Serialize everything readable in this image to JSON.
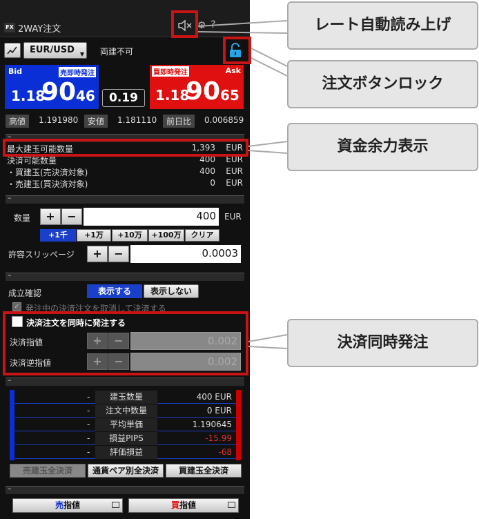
{
  "window": {
    "title": "2WAY注文",
    "app_badge": "FX"
  },
  "toolbar": {
    "pair": "EUR/USD",
    "mode": "両建不可"
  },
  "bid": {
    "label": "Bid",
    "tag": "売即時発注",
    "price_small": "1.18",
    "price_big": "90",
    "price_end": "46"
  },
  "ask": {
    "label": "Ask",
    "tag": "買即時発注",
    "price_small": "1.18",
    "price_big": "90",
    "price_end": "65"
  },
  "spread": "0.19",
  "stats": {
    "high_label": "高値",
    "high": "1.191980",
    "low_label": "安値",
    "low": "1.181110",
    "change_label": "前日比",
    "change": "0.006859"
  },
  "margin": {
    "max_label": "最大建玉可能数量",
    "max_value": "1,393",
    "unit": "EUR",
    "settle_label": "決済可能数量",
    "settle_value": "400",
    "buy_label": "・買建玉(売決済対象)",
    "buy_value": "400",
    "sell_label": "・売建玉(買決済対象)",
    "sell_value": "0"
  },
  "order": {
    "qty_label": "数量",
    "qty_value": "400",
    "qty_unit": "EUR",
    "quick": [
      "+1千",
      "+1万",
      "+10万",
      "+100万",
      "クリア"
    ],
    "slip_label": "許容スリッページ",
    "slip_value": "0.0003",
    "plus": "+",
    "minus": "−"
  },
  "confirm": {
    "label": "成立確認",
    "show": "表示する",
    "hide": "表示しない",
    "cancel_check": "発注中の決済注文を取消して決済する"
  },
  "settle": {
    "check_label": "決済注文を同時に発注する",
    "limit_label": "決済指値",
    "limit_value": "0.002",
    "stop_label": "決済逆指値",
    "stop_value": "0.002"
  },
  "positions": {
    "rows": [
      {
        "label": "建玉数量",
        "left": "-",
        "right": "400 EUR",
        "neg": false
      },
      {
        "label": "注文中数量",
        "left": "-",
        "right": "0 EUR",
        "neg": false
      },
      {
        "label": "平均単価",
        "left": "-",
        "right": "1.190645",
        "neg": false
      },
      {
        "label": "損益PIPS",
        "left": "-",
        "right": "-15.99",
        "neg": true
      },
      {
        "label": "評価損益",
        "left": "-",
        "right": "-68",
        "neg": true
      }
    ],
    "close_sell": "売建玉全決済",
    "close_pair": "通貨ペア別全決済",
    "close_buy": "買建玉全決済"
  },
  "bottom": {
    "sell_prefix": "売",
    "buy_prefix": "買",
    "suffix": "指値"
  },
  "callouts": {
    "voice": "レート自動読み上げ",
    "lock": "注文ボタンロック",
    "margin": "資金余力表示",
    "settle": "決済同時発注"
  },
  "colors": {
    "bid": "#0a2fd6",
    "ask": "#e01010",
    "highlight": "#c81414",
    "selected": "#1a3fc8"
  }
}
